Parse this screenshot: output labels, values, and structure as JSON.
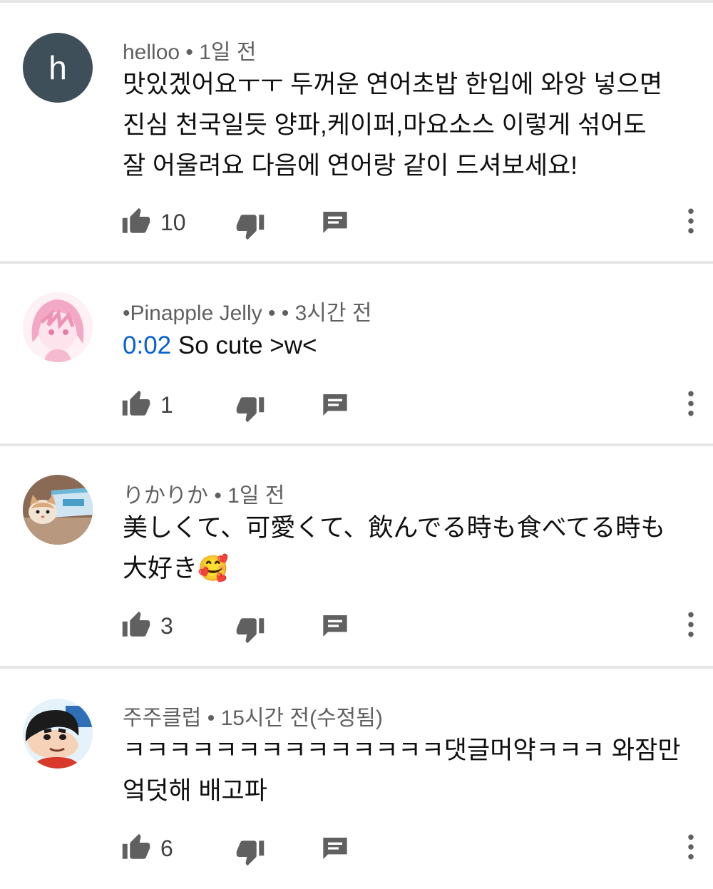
{
  "comments": [
    {
      "author": "helloo",
      "time": " • 1일 전",
      "avatar_letter": "h",
      "timestamp": "",
      "text": "맛있겠어요ㅜㅜ 두꺼운 연어초밥 한입에 와앙 넣으면\n진심 천국일듯 양파,케이퍼,마요소스 이렇게 섞어도\n잘 어울려요 다음에 연어랑 같이 드셔보세요!",
      "likes": "10"
    },
    {
      "author": "•Pinapple Jelly •",
      "time": " • 3시간 전",
      "avatar_letter": "",
      "timestamp": "0:02",
      "text": " So cute >w<",
      "likes": "1"
    },
    {
      "author": "りかりか",
      "time": " • 1일 전",
      "avatar_letter": "",
      "timestamp": "",
      "text": "美しくて、可愛くて、飲んでる時も食べてる時も\n大好き🥰",
      "likes": "3"
    },
    {
      "author": "주주클럽",
      "time": " • 15시간 전(수정됨)",
      "avatar_letter": "",
      "timestamp": "",
      "text": "ㅋㅋㅋㅋㅋㅋㅋㅋㅋㅋㅋㅋㅋㅋ댓글머약ㅋㅋㅋ 와잠만\n엌덧해 배고파",
      "likes": "6"
    }
  ],
  "colors": {
    "avatar_h": "#3e4f5a",
    "meta": "#606060",
    "timestamp_link": "#065fd4",
    "divider": "#e6e6e6"
  }
}
